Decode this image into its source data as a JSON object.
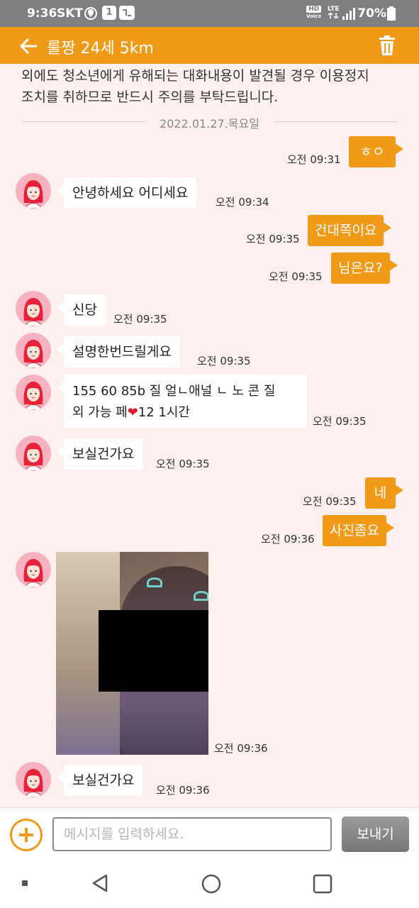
{
  "status_bar": {
    "time": "9:36",
    "carrier": "SKT",
    "badge_one": "1",
    "hd_label": "HD",
    "voice_label": "Voice",
    "lte_label": "LTE",
    "battery": "70%"
  },
  "header": {
    "title": "룰짱 24세 5km",
    "back_icon": "back-arrow-icon",
    "delete_icon": "trash-icon",
    "accent_color": "#f09a18"
  },
  "notice": {
    "line1": "외에도 청소년에게 유해되는 대화내용이 발견될 경우 이용정지",
    "line2": "조치를 취하므로 반드시 주의를 부탁드립니다."
  },
  "date_separator": "2022.01.27.목요일",
  "messages": [
    {
      "side": "out",
      "text": "ㅎㅇ",
      "time": "오전 09:31"
    },
    {
      "side": "in",
      "text": "안녕하세요 어디세요",
      "time": "오전 09:34"
    },
    {
      "side": "out",
      "text": "건대쪽이요",
      "time": "오전 09:35"
    },
    {
      "side": "out",
      "text": "님은요?",
      "time": "오전 09:35"
    },
    {
      "side": "in",
      "text": "신당",
      "time": "오전 09:35"
    },
    {
      "side": "in",
      "text": "설명한번드릴게요",
      "time": "오전 09:35"
    },
    {
      "side": "in",
      "text_line1": "155 60 85b 질 얼ㄴ애널 ㄴ 노 콘 질",
      "text_line2_prefix": "외 가능 페",
      "heart": "❤",
      "text_line2_suffix": "12 1시간",
      "time": "오전 09:35"
    },
    {
      "side": "in",
      "text": "보실건가요",
      "time": "오전 09:35"
    },
    {
      "side": "out",
      "text": "네",
      "time": "오전 09:35"
    },
    {
      "side": "out",
      "text": "사진좀요",
      "time": "오전 09:36"
    },
    {
      "side": "in",
      "type": "photo",
      "time": "오전 09:36"
    },
    {
      "side": "in",
      "text": "보실건가요",
      "time": "오전 09:36"
    }
  ],
  "input": {
    "placeholder": "메시지를 입력하세요.",
    "send_label": "보내기",
    "plus_icon": "plus-circle-icon"
  },
  "nav_bar": {
    "icons": [
      "recent-dot-icon",
      "back-triangle-icon",
      "home-circle-icon",
      "overview-square-icon"
    ]
  }
}
